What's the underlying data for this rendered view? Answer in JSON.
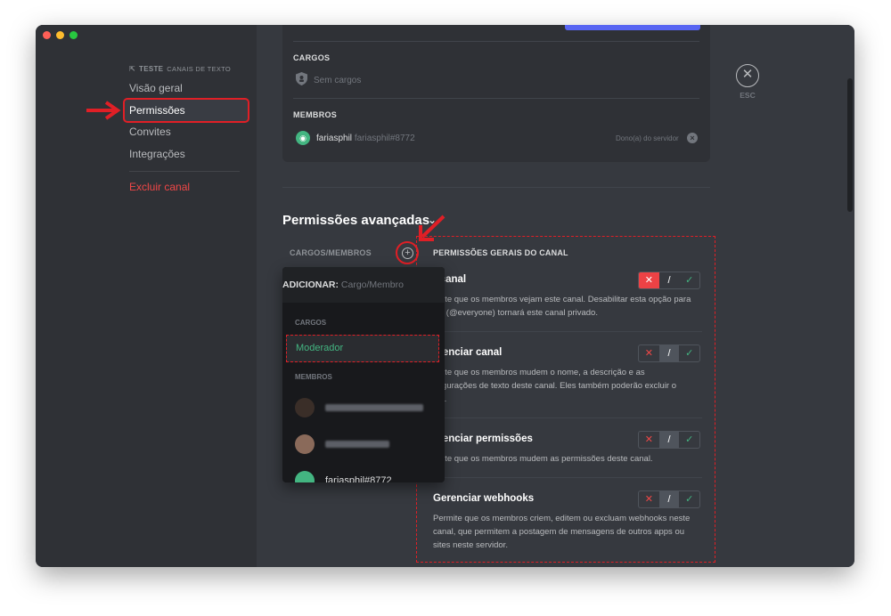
{
  "sidebar": {
    "channel_name": "TESTE",
    "category": "CANAIS DE TEXTO",
    "items": [
      {
        "label": "Visão geral"
      },
      {
        "label": "Permissões"
      },
      {
        "label": "Convites"
      },
      {
        "label": "Integrações"
      }
    ],
    "delete_label": "Excluir canal"
  },
  "close": {
    "label": "ESC"
  },
  "roles_section": {
    "title": "CARGOS",
    "empty": "Sem cargos"
  },
  "members_section": {
    "title": "MEMBROS",
    "member": {
      "name": "fariasphil",
      "tag": "fariasphil#8772",
      "role_note": "Dono(a) do servidor"
    }
  },
  "advanced": {
    "title": "Permissões avançadas"
  },
  "role_list": {
    "header": "CARGOS/MEMBROS"
  },
  "dropdown": {
    "prefix": "ADICIONAR:",
    "placeholder": "Cargo/Membro",
    "roles_header": "CARGOS",
    "role": "Moderador",
    "members_header": "MEMBROS",
    "visible_member": "fariasphil#8772"
  },
  "permissions": {
    "header": "PERMISSÕES GERAIS DO CANAL",
    "items": [
      {
        "title": "r canal",
        "desc1": "rmite que os membros vejam este canal. Desabilitar esta opção para",
        "desc2": "los (@everyone) tornará este canal privado.",
        "state": "deny"
      },
      {
        "title": "erenciar canal",
        "desc1": "rmite que os membros mudem o nome, a descrição e as",
        "desc2": "nfigurações de texto deste canal. Eles também poderão excluir o",
        "desc3": "nal.",
        "state": "neutral"
      },
      {
        "title": "erenciar permissões",
        "desc1": "rmite que os membros mudem as permissões deste canal.",
        "state": "neutral"
      },
      {
        "title": "Gerenciar webhooks",
        "desc1": "Permite que os membros criem, editem ou excluam webhooks neste",
        "desc2": "canal, que permitem a postagem de mensagens de outros apps ou",
        "desc3": "sites neste servidor.",
        "state": "neutral"
      }
    ]
  },
  "colors": {
    "accent": "#5865f2",
    "danger": "#ed4245",
    "success": "#43b581",
    "annotation": "#e01f26"
  }
}
